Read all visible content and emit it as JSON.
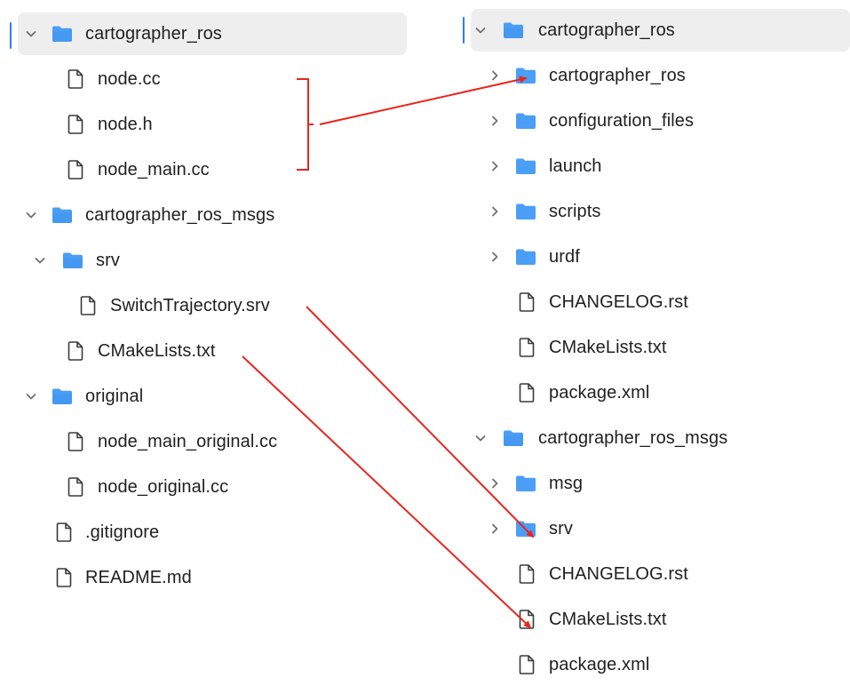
{
  "left_tree": {
    "items": [
      {
        "label": "cartographer_ros",
        "type": "folder",
        "expanded": true
      },
      {
        "label": "node.cc",
        "type": "file"
      },
      {
        "label": "node.h",
        "type": "file"
      },
      {
        "label": "node_main.cc",
        "type": "file"
      },
      {
        "label": "cartographer_ros_msgs",
        "type": "folder",
        "expanded": true
      },
      {
        "label": "srv",
        "type": "folder",
        "expanded": true
      },
      {
        "label": "SwitchTrajectory.srv",
        "type": "file"
      },
      {
        "label": "CMakeLists.txt",
        "type": "file"
      },
      {
        "label": "original",
        "type": "folder",
        "expanded": true
      },
      {
        "label": "node_main_original.cc",
        "type": "file"
      },
      {
        "label": "node_original.cc",
        "type": "file"
      },
      {
        "label": ".gitignore",
        "type": "file"
      },
      {
        "label": "README.md",
        "type": "file"
      }
    ]
  },
  "right_tree": {
    "items": [
      {
        "label": "cartographer_ros",
        "type": "folder",
        "expanded": true
      },
      {
        "label": "cartographer_ros",
        "type": "folder",
        "expanded": false
      },
      {
        "label": "configuration_files",
        "type": "folder",
        "expanded": false
      },
      {
        "label": "launch",
        "type": "folder",
        "expanded": false
      },
      {
        "label": "scripts",
        "type": "folder",
        "expanded": false
      },
      {
        "label": "urdf",
        "type": "folder",
        "expanded": false
      },
      {
        "label": "CHANGELOG.rst",
        "type": "file"
      },
      {
        "label": "CMakeLists.txt",
        "type": "file"
      },
      {
        "label": "package.xml",
        "type": "file"
      },
      {
        "label": "cartographer_ros_msgs",
        "type": "folder",
        "expanded": true
      },
      {
        "label": "msg",
        "type": "folder",
        "expanded": false
      },
      {
        "label": "srv",
        "type": "folder",
        "expanded": false
      },
      {
        "label": "CHANGELOG.rst",
        "type": "file"
      },
      {
        "label": "CMakeLists.txt",
        "type": "file"
      },
      {
        "label": "package.xml",
        "type": "file"
      }
    ]
  },
  "colors": {
    "folder": "#4a9ef5",
    "folder_dark": "#3b8de8",
    "arrow": "#e8261f",
    "selection": "#eeeeef",
    "focus": "#2f7cf6",
    "text": "#1f1f1f",
    "file_icon": "#3a3a3a",
    "chevron": "#6e6e6e"
  },
  "icons": {
    "folder": "folder-icon",
    "file": "file-icon",
    "expanded": "chevron-down-icon",
    "collapsed": "chevron-right-icon"
  }
}
